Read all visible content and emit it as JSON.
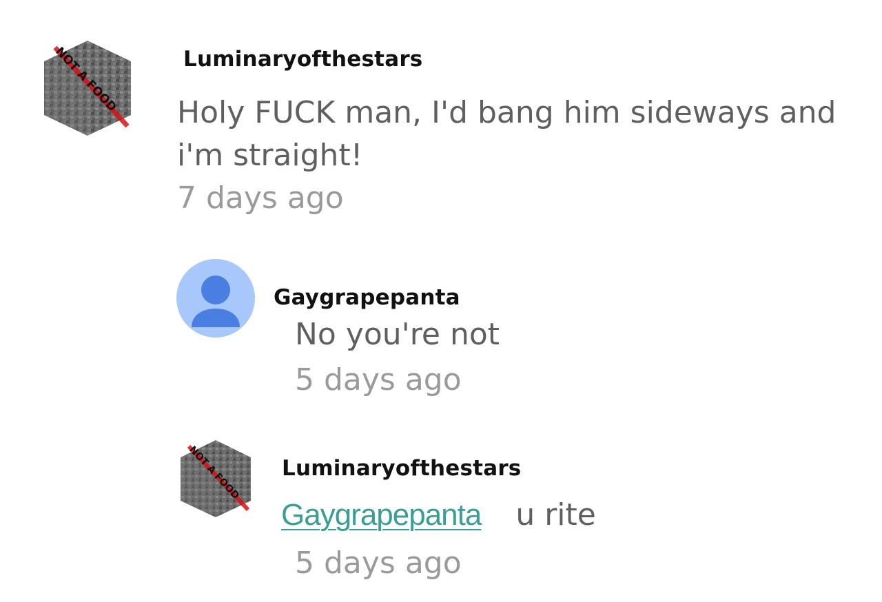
{
  "comments": [
    {
      "author": "Luminaryofthestars",
      "avatar_icon": "stone-block-not-a-food-icon",
      "avatar_text": "NOT A FOOD",
      "text": "Holy FUCK man, I'd bang him sideways and i'm straight!",
      "time": "7 days ago"
    },
    {
      "author": "Gaygrapepanta",
      "avatar_icon": "default-user-icon",
      "text": "No you're not",
      "time": "5 days ago"
    },
    {
      "author": "Luminaryofthestars",
      "avatar_icon": "stone-block-not-a-food-icon",
      "avatar_text": "NOT A FOOD",
      "mention": "Gaygrapepanta",
      "text": "u rite",
      "time": "5 days ago"
    }
  ],
  "colors": {
    "text": "#5f5f5f",
    "timestamp": "#9a9a9a",
    "mention": "#3a9e94",
    "avatar_bg": "#a8c7fa",
    "avatar_fg": "#4a7ee0"
  }
}
